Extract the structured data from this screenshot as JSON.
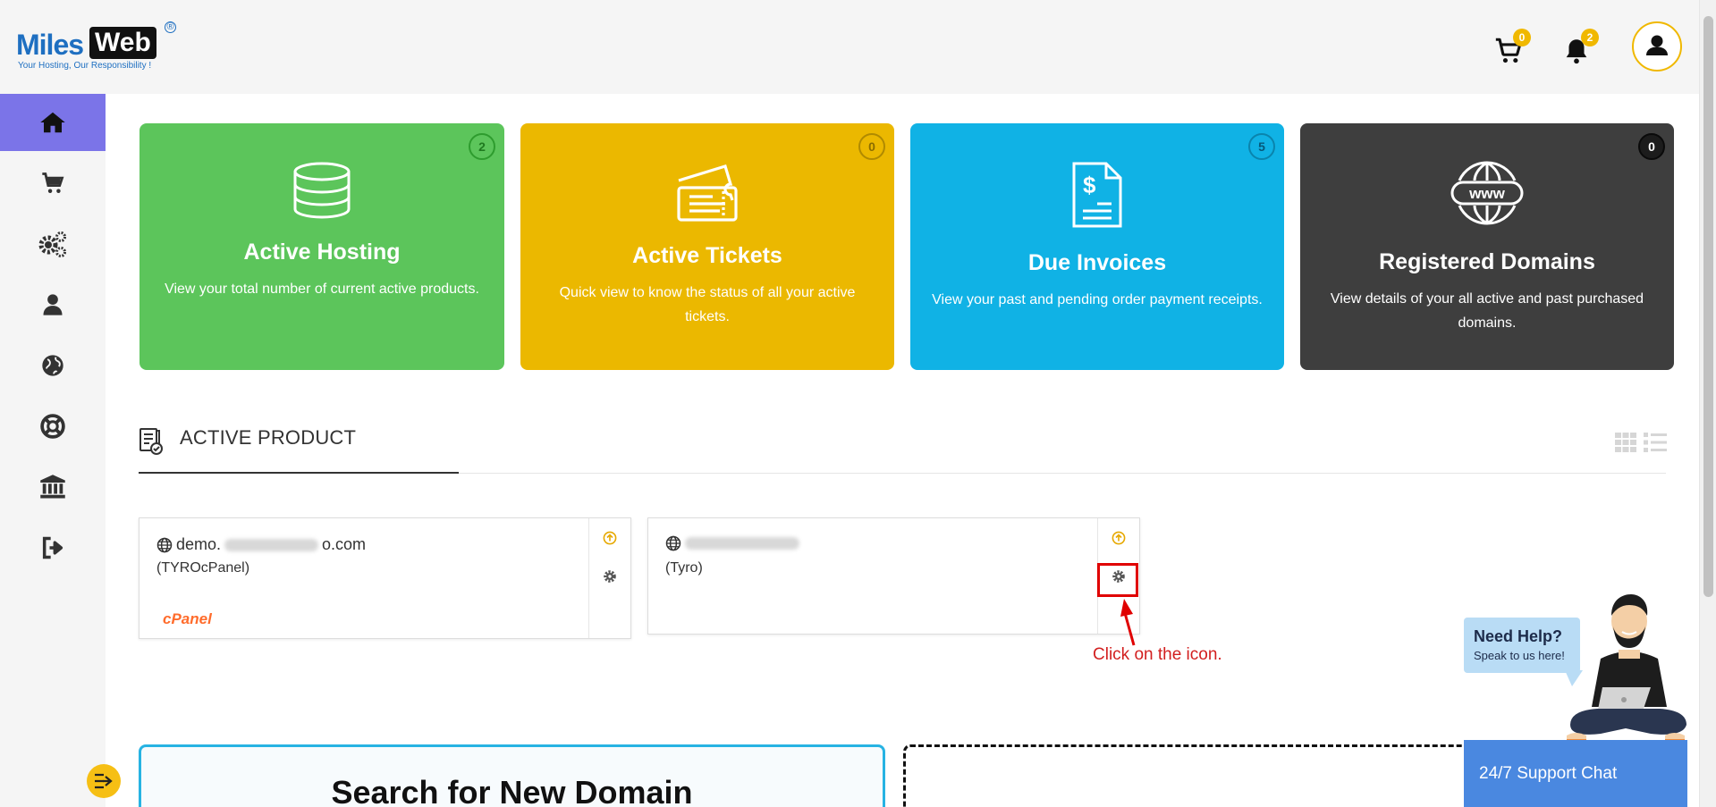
{
  "brand": {
    "name_part1": "Miles",
    "name_part2": "Web",
    "registered": "®",
    "tagline": "Your Hosting, Our Responsibility !"
  },
  "header": {
    "cart_count": "0",
    "notifications_count": "2"
  },
  "sidebar": {
    "items": [
      {
        "icon": "home-icon",
        "active": true
      },
      {
        "icon": "cart-icon"
      },
      {
        "icon": "gears-icon"
      },
      {
        "icon": "user-icon"
      },
      {
        "icon": "globe-icon"
      },
      {
        "icon": "lifebuoy-icon"
      },
      {
        "icon": "bank-icon"
      },
      {
        "icon": "logout-icon"
      }
    ]
  },
  "cards": [
    {
      "title": "Active Hosting",
      "desc": "View your total number of current active products.",
      "count": "2",
      "color": "#5cc55b",
      "icon": "database-icon"
    },
    {
      "title": "Active Tickets",
      "desc": "Quick view to know the  status of all your active tickets.",
      "count": "0",
      "color": "#ebb800",
      "icon": "tickets-icon"
    },
    {
      "title": "Due Invoices",
      "desc": "View your past and pending order payment receipts.",
      "count": "5",
      "color": "#10b2e5",
      "icon": "invoice-icon"
    },
    {
      "title": "Registered Domains",
      "desc": "View details of your all active and past purchased domains.",
      "count": "0",
      "color": "#3e3e3e",
      "icon": "www-icon"
    }
  ],
  "active_product": {
    "title": "ACTIVE PRODUCT"
  },
  "products": [
    {
      "domain_prefix": "demo.",
      "domain_suffix": "o.com",
      "plan": "(TYROcPanel)",
      "panel_logo": "cPanel"
    },
    {
      "domain_prefix": "",
      "domain_suffix": "",
      "plan": "(Tyro)",
      "panel_logo": ""
    }
  ],
  "annotation": {
    "note": "Click on the icon."
  },
  "search": {
    "title": "Search for New Domain"
  },
  "help": {
    "title": "Need Help?",
    "subtitle": "Speak to us here!",
    "support_label": "24/7 Support Chat"
  }
}
